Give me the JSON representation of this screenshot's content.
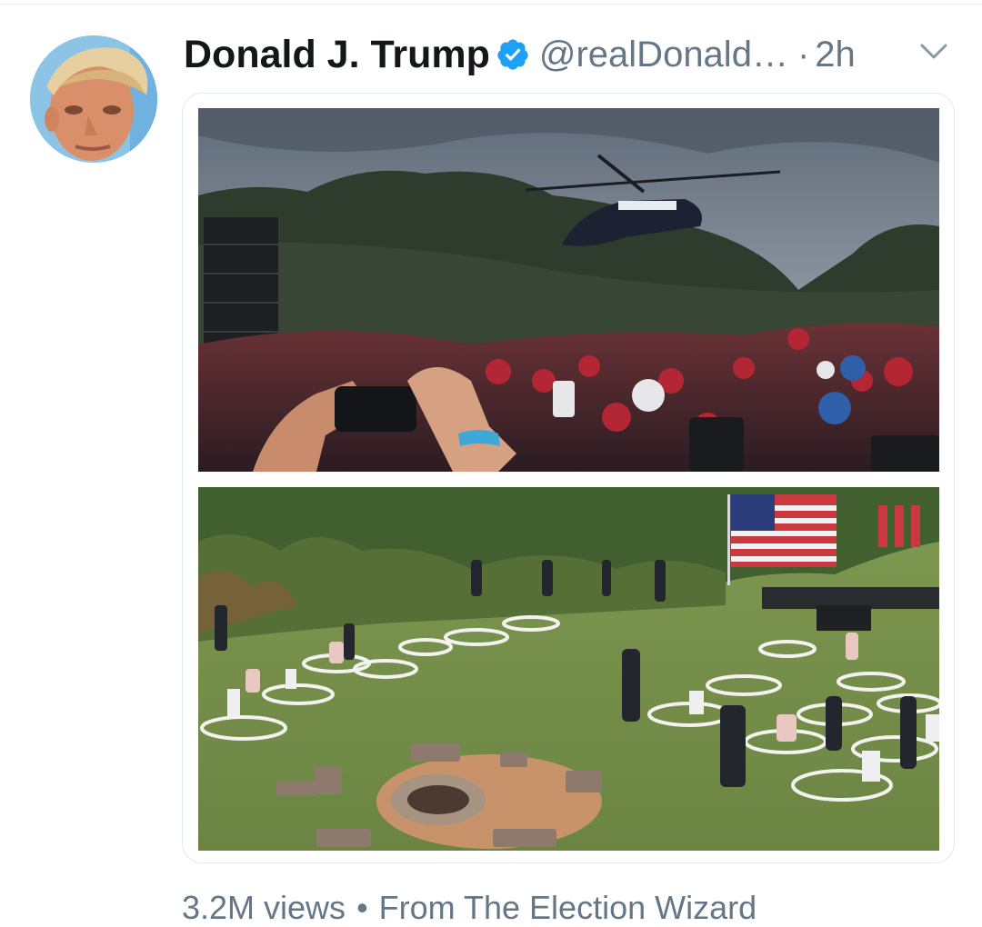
{
  "tweet": {
    "display_name": "Donald J. Trump",
    "handle": "@realDonald…",
    "separator": "·",
    "time": "2h",
    "verified": true,
    "media": [
      {
        "subject": "helicopter-rally-crowd"
      },
      {
        "subject": "outdoor-event-circles"
      }
    ],
    "footer": {
      "views": "3.2M views",
      "separator": "•",
      "source": "From The Election Wizard"
    }
  },
  "icons": {
    "verified": "verified-badge-icon",
    "menu": "chevron-down-icon"
  },
  "colors": {
    "verified": "#1da1f2",
    "secondary_text": "#657786",
    "primary_text": "#14171a"
  }
}
